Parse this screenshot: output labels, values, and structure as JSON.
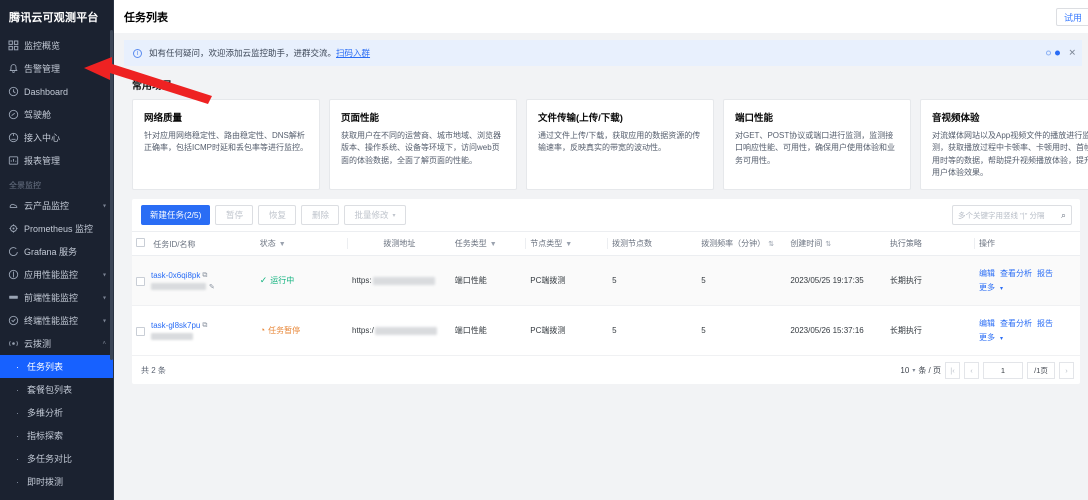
{
  "brand": {
    "title": "腾讯云可观测平台"
  },
  "sidebar": {
    "items": [
      {
        "label": "监控概览",
        "icon": "grid-icon",
        "caret": ""
      },
      {
        "label": "告警管理",
        "icon": "bell-icon",
        "caret": ""
      },
      {
        "label": "Dashboard",
        "icon": "clock-icon",
        "caret": ""
      },
      {
        "label": "驾驶舱",
        "icon": "gauge-icon",
        "caret": ""
      },
      {
        "label": "接入中心",
        "icon": "plug-icon",
        "caret": ""
      },
      {
        "label": "报表管理",
        "icon": "report-icon",
        "caret": ""
      }
    ],
    "group_title": "全景监控",
    "group_items": [
      {
        "label": "云产品监控",
        "icon": "cloud-icon",
        "caret": "▾"
      },
      {
        "label": "Prometheus 监控",
        "icon": "prometheus-icon",
        "caret": ""
      },
      {
        "label": "Grafana 服务",
        "icon": "grafana-icon",
        "caret": ""
      },
      {
        "label": "应用性能监控",
        "icon": "apm-icon",
        "caret": "▾"
      },
      {
        "label": "前端性能监控",
        "icon": "rum-icon",
        "caret": "▾"
      },
      {
        "label": "终端性能监控",
        "icon": "device-icon",
        "caret": "▾"
      },
      {
        "label": "云拨测",
        "icon": "dial-icon",
        "caret": "˄"
      }
    ],
    "sub_items": [
      {
        "label": "任务列表",
        "active": true
      },
      {
        "label": "套餐包列表",
        "active": false
      },
      {
        "label": "多维分析",
        "active": false
      },
      {
        "label": "指标探索",
        "active": false
      },
      {
        "label": "多任务对比",
        "active": false
      },
      {
        "label": "即时拨测",
        "active": false
      }
    ]
  },
  "header": {
    "title": "任务列表",
    "right_button": "试用"
  },
  "banner": {
    "text": "如有任何疑问，欢迎添加云监控助手，进群交流。",
    "link": "扫码入群",
    "info_icon": "info-icon",
    "close_icon": "close-icon"
  },
  "scenes": {
    "title": "常用场景",
    "cards": [
      {
        "title": "网络质量",
        "desc": "针对应用网络稳定性、路由稳定性、DNS解析正确率，包括ICMP时延和丢包率等进行监控。"
      },
      {
        "title": "页面性能",
        "desc": "获取用户在不同的运营商、城市地域、浏览器版本、操作系统、设备等环境下，访问web页面的体验数据，全面了解页面的性能。"
      },
      {
        "title": "文件传输(上传/下载)",
        "desc": "通过文件上传/下载，获取应用的数据资源的传输速率，反映真实的带宽的波动性。"
      },
      {
        "title": "端口性能",
        "desc": "对GET、POST协议或端口进行监测，监测接口响应性能、可用性，确保用户使用体验和业务可用性。"
      },
      {
        "title": "音视频体验",
        "desc": "对流媒体网站以及App视频文件的播放进行监测，获取播放过程中卡顿率、卡顿用时、首帧用时等的数据，帮助提升视频播放体验，提升用户体验效果。"
      }
    ]
  },
  "toolbar": {
    "create_label": "新建任务(2/5)",
    "pause_label": "暂停",
    "resume_label": "恢复",
    "delete_label": "删除",
    "batch_label": "批量修改",
    "batch_caret": "▾"
  },
  "search": {
    "placeholder": "多个关键字用竖线 \"|\" 分隔",
    "value": "",
    "icon": "search-icon"
  },
  "table": {
    "columns": [
      {
        "label": "任务ID/名称",
        "filter": ""
      },
      {
        "label": "状态",
        "filter": "filter-icon"
      },
      {
        "label": "拨测地址",
        "filter": ""
      },
      {
        "label": "任务类型",
        "filter": "filter-icon"
      },
      {
        "label": "节点类型",
        "filter": "filter-icon"
      },
      {
        "label": "拨测节点数",
        "filter": ""
      },
      {
        "label": "拨测频率（分钟）",
        "filter": "sort-icon"
      },
      {
        "label": "创建时间",
        "filter": "sort-icon"
      },
      {
        "label": "执行策略",
        "filter": ""
      },
      {
        "label": "操作",
        "filter": ""
      }
    ],
    "rows": [
      {
        "task_id": "task-0x6qi8pk",
        "status": "运行中",
        "status_kind": "run",
        "status_icon": "check-circle-icon",
        "url_prefix": "https:",
        "task_type": "端口性能",
        "node_type": "PC端拨测",
        "node_count": "5",
        "frequency": "5",
        "created": "2023/05/25 19:17:35",
        "policy": "长期执行",
        "actions": [
          "编辑",
          "查看分析",
          "报告"
        ],
        "more": "更多"
      },
      {
        "task_id": "task-gl8sk7pu",
        "status": "任务暂停",
        "status_kind": "pause",
        "status_icon": "pause-circle-icon",
        "url_prefix": "https:/",
        "task_type": "端口性能",
        "node_type": "PC端拨测",
        "node_count": "5",
        "frequency": "5",
        "created": "2023/05/26 15:37:16",
        "policy": "长期执行",
        "actions": [
          "编辑",
          "查看分析",
          "报告"
        ],
        "more": "更多"
      }
    ]
  },
  "pager": {
    "total_text": "共 2 条",
    "page_size": "10",
    "page_size_suffix": "条 / 页",
    "first": "|‹",
    "prev": "‹",
    "current_page": "1",
    "total_pages": "/1页",
    "next": "›"
  },
  "annotation": {
    "arrow_color": "#ee2222",
    "target": "告警管理"
  }
}
